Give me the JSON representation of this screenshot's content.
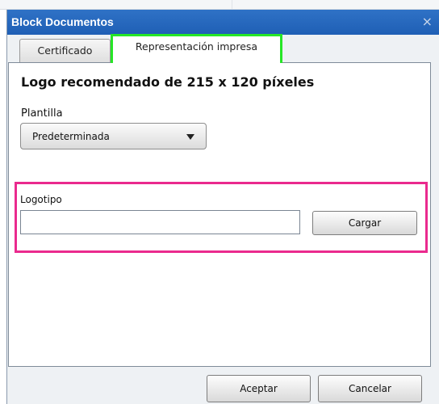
{
  "dialog": {
    "title": "Block Documentos",
    "close_glyph": "×"
  },
  "tabs": [
    {
      "label": "Certificado",
      "active": false
    },
    {
      "label": "Representación impresa",
      "active": true
    }
  ],
  "panel": {
    "heading": "Logo recomendado de 215 x 120 píxeles",
    "template_label": "Plantilla",
    "template_value": "Predeterminada",
    "logo_label": "Logotipo",
    "logo_value": "",
    "load_button": "Cargar"
  },
  "footer": {
    "accept": "Aceptar",
    "cancel": "Cancelar"
  },
  "colors": {
    "titlebar": "#1f5fb5",
    "active_tab_highlight": "#26e626",
    "logo_section_highlight": "#ea2a8e"
  },
  "icons": {
    "close": "close-icon",
    "dropdown": "chevron-down-icon"
  }
}
